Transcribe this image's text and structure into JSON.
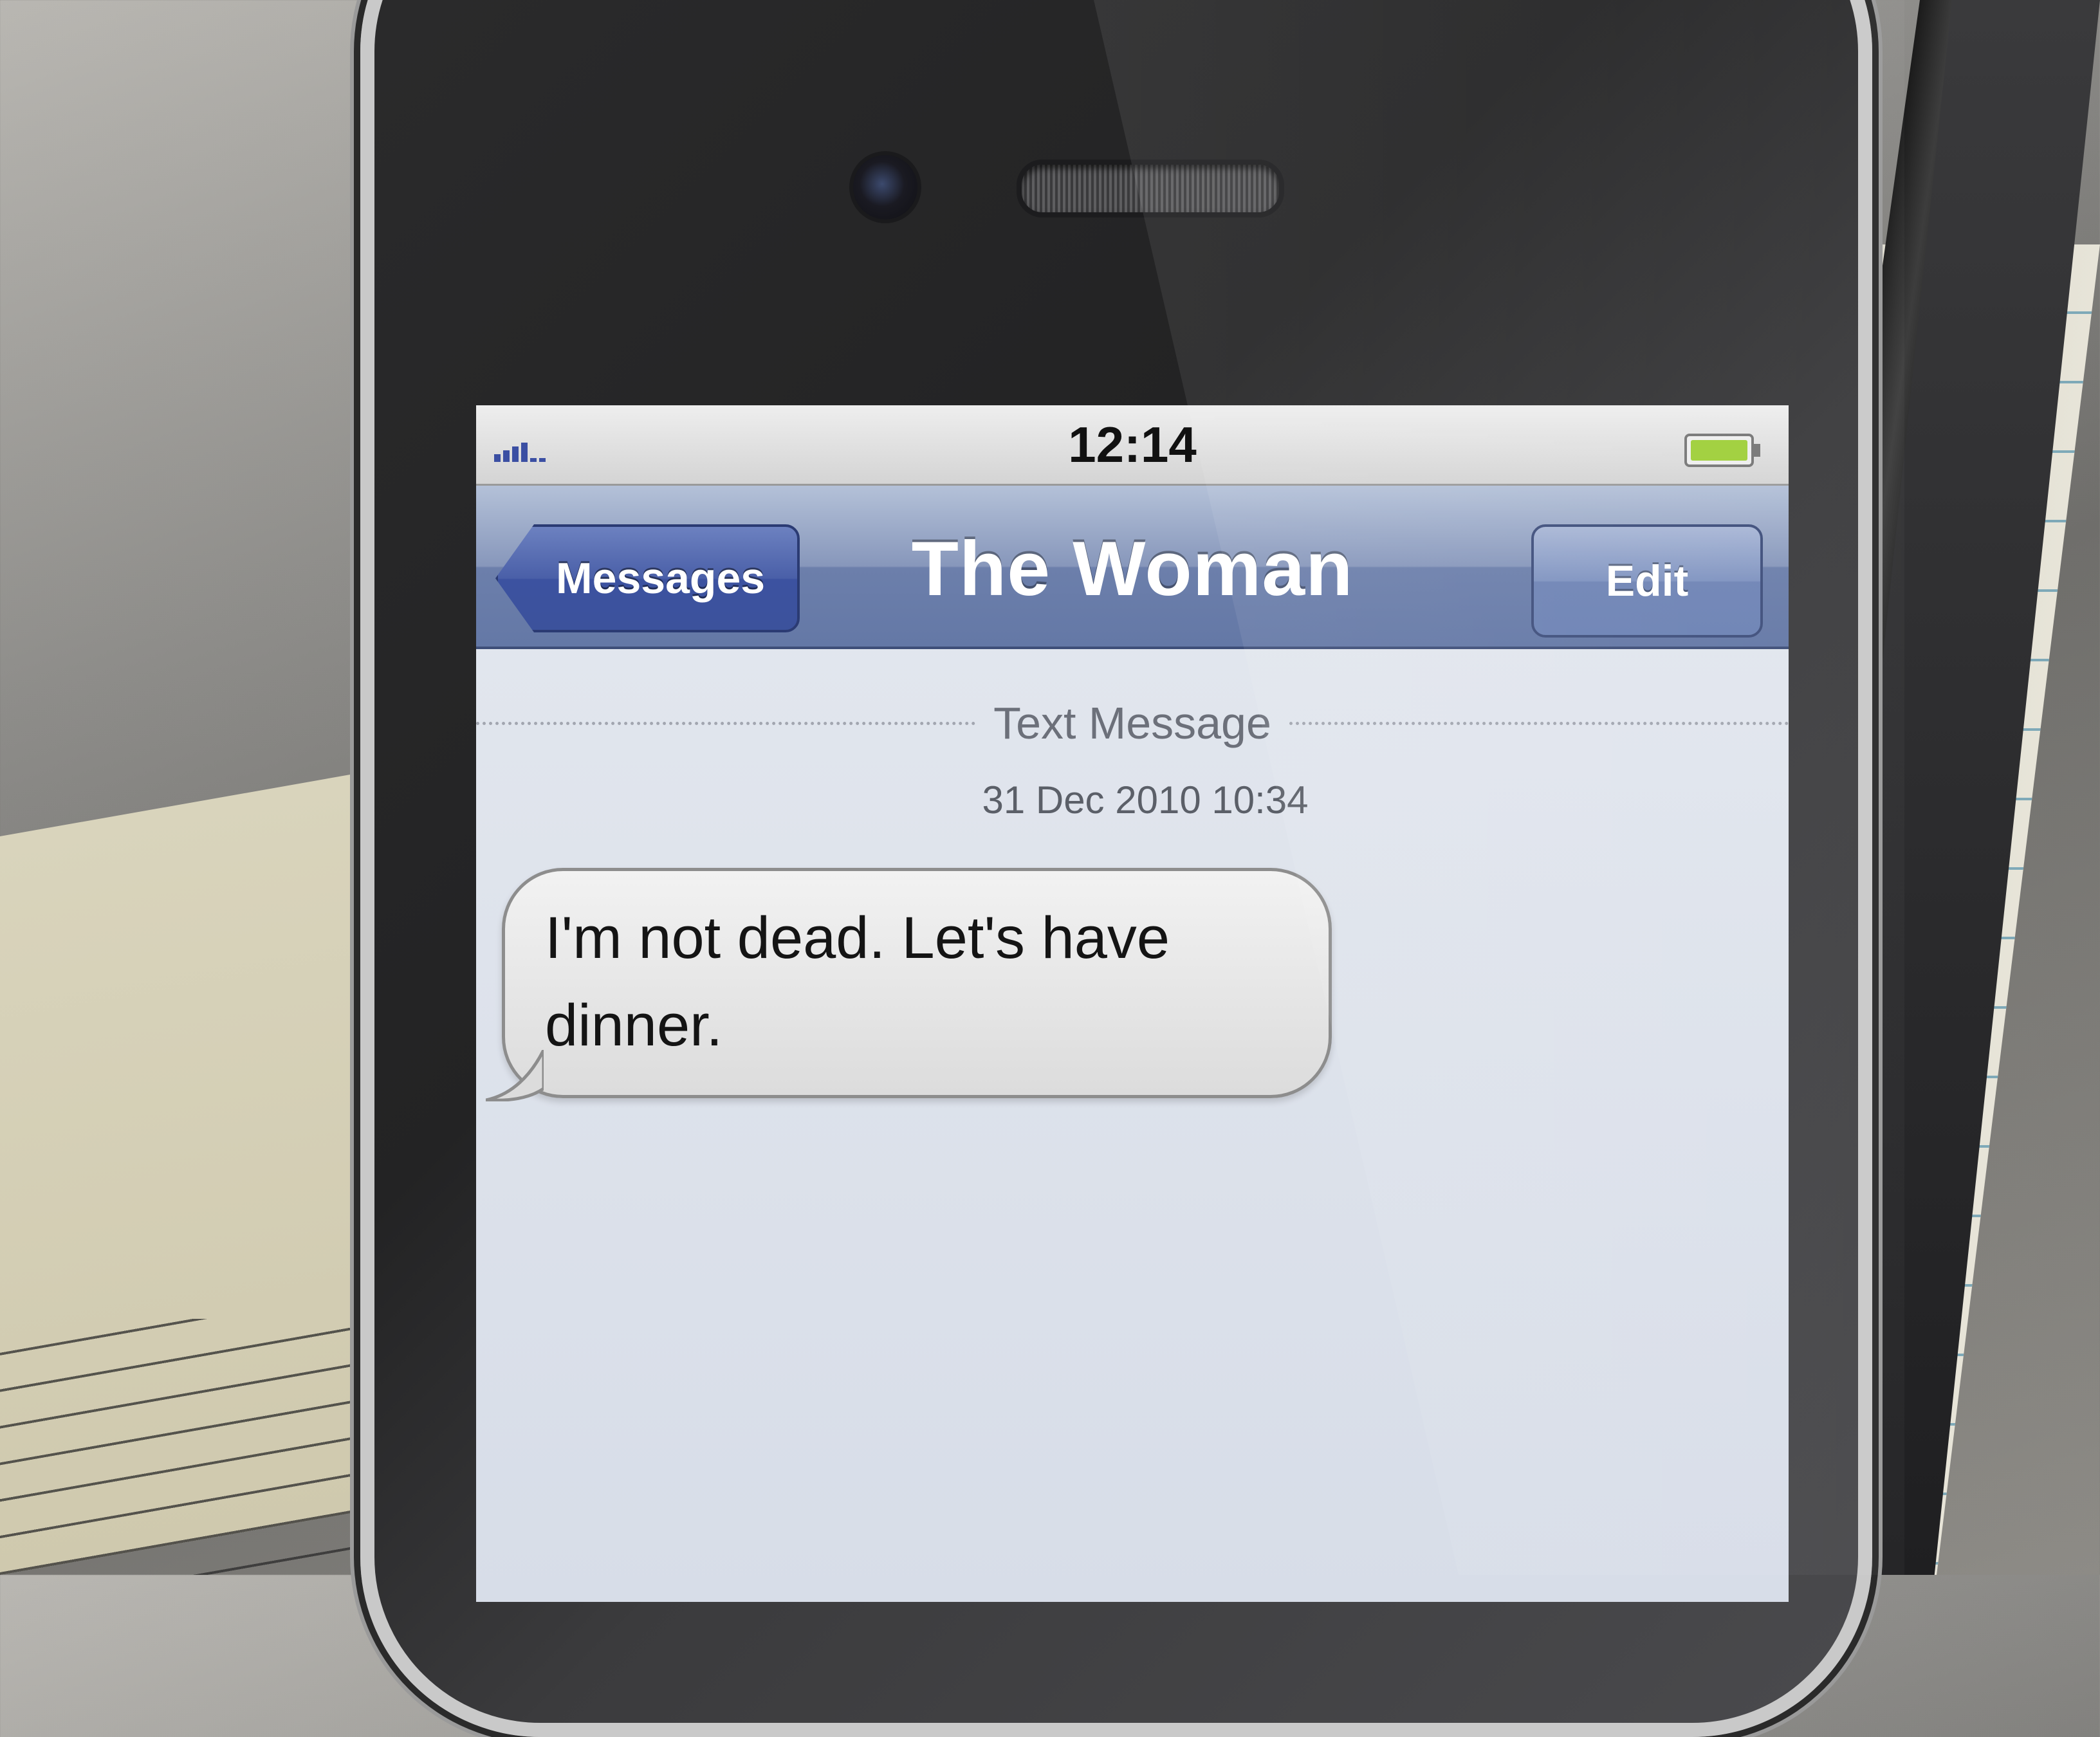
{
  "status_bar": {
    "time": "12:14"
  },
  "nav_bar": {
    "back_label": "Messages",
    "title": "The Woman",
    "edit_label": "Edit"
  },
  "thread": {
    "separator_label": "Text Message",
    "timestamp": "31 Dec 2010 10:34",
    "messages": [
      {
        "direction": "incoming",
        "text": "I'm not dead. Let's have dinner."
      }
    ]
  },
  "colors": {
    "nav_bar": "#6c7fab",
    "back_button": "#3c52a0",
    "bubble": "#e6e6e6"
  },
  "icons": [
    "signal-icon",
    "battery-icon"
  ]
}
